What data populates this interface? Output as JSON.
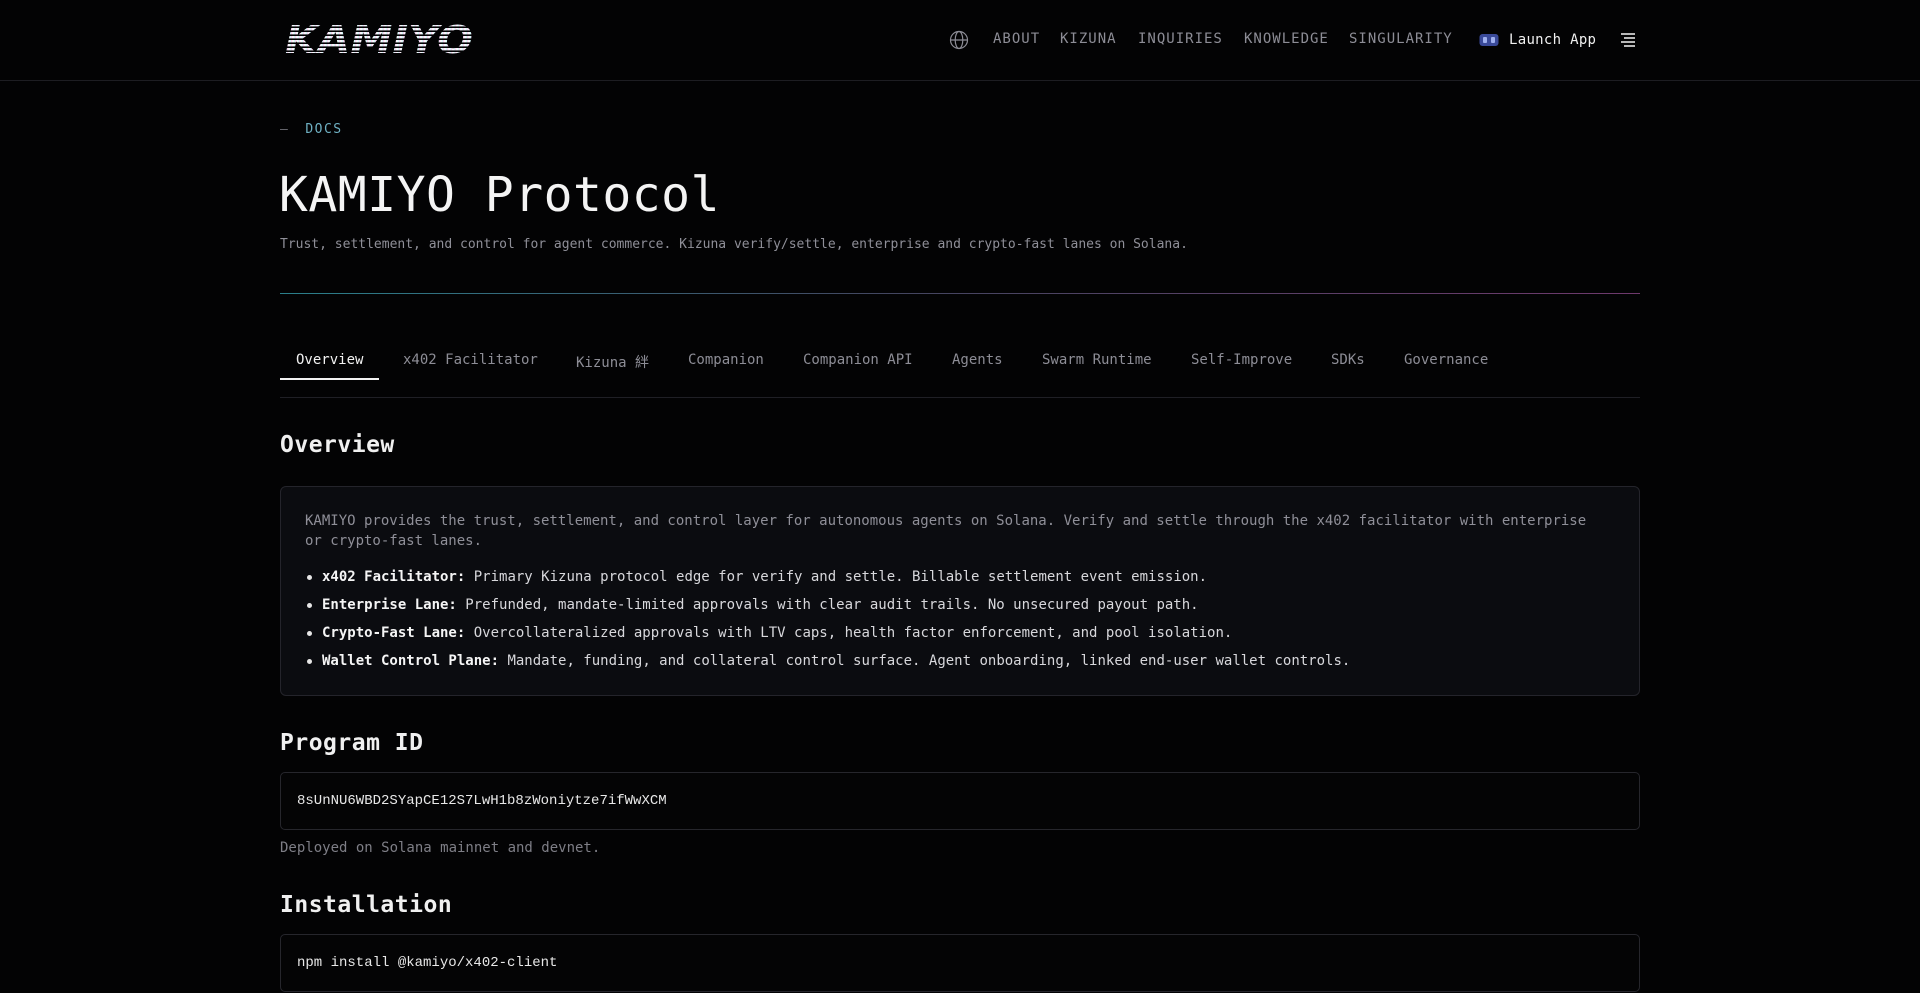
{
  "header": {
    "logo_text": "KAMIYO",
    "nav": [
      "ABOUT",
      "KIZUNA",
      "INQUIRIES",
      "KNOWLEDGE",
      "SINGULARITY"
    ],
    "launch_label": "Launch App",
    "icons": {
      "language": "globe-icon",
      "wallet": "wallet-icon",
      "menu": "menu-icon"
    }
  },
  "hero": {
    "crumb_dash": "—",
    "crumb": "DOCS",
    "title": "KAMIYO Protocol",
    "subtitle": "Trust, settlement, and control for agent commerce. Kizuna verify/settle, enterprise and crypto-fast lanes on Solana."
  },
  "tabs": [
    "Overview",
    "x402 Facilitator",
    "Kizuna 絆",
    "Companion",
    "Companion API",
    "Agents",
    "Swarm Runtime",
    "Self-Improve",
    "SDKs",
    "Governance"
  ],
  "active_tab": "Overview",
  "overview": {
    "heading": "Overview",
    "intro": "KAMIYO provides the trust, settlement, and control layer for autonomous agents on Solana. Verify and settle through the x402 facilitator with enterprise or crypto-fast lanes.",
    "items": [
      {
        "label": "x402 Facilitator:",
        "text": "Primary Kizuna protocol edge for verify and settle. Billable settlement event emission."
      },
      {
        "label": "Enterprise Lane:",
        "text": "Prefunded, mandate-limited approvals with clear audit trails. No unsecured payout path."
      },
      {
        "label": "Crypto-Fast Lane:",
        "text": "Overcollateralized approvals with LTV caps, health factor enforcement, and pool isolation."
      },
      {
        "label": "Wallet Control Plane:",
        "text": "Mandate, funding, and collateral control surface. Agent onboarding, linked end-user wallet controls."
      }
    ]
  },
  "program": {
    "heading": "Program ID",
    "id": "8sUnNU6WBD2SYapCE12S7LwH1b8zWoniytze7ifWwXCM",
    "note": "Deployed on Solana mainnet and devnet."
  },
  "installation": {
    "heading": "Installation",
    "command": "npm install @kamiyo/x402-client"
  },
  "colors": {
    "background": "#030304",
    "accent_cyan": "#6fb1c4",
    "divider_start": "#2f8d9a",
    "divider_end": "#7a3f78",
    "card_bg": "#0b0c10"
  }
}
